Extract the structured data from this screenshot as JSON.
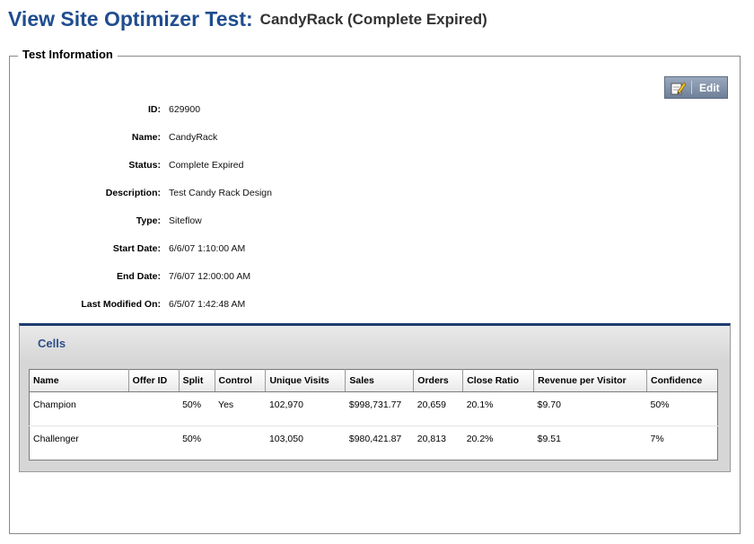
{
  "header": {
    "title": "View Site Optimizer Test:",
    "subtitle": "CandyRack (Complete Expired)"
  },
  "test_info": {
    "legend": "Test Information",
    "edit_label": "Edit",
    "fields": [
      {
        "label": "ID:",
        "value": "629900"
      },
      {
        "label": "Name:",
        "value": "CandyRack"
      },
      {
        "label": "Status:",
        "value": "Complete Expired"
      },
      {
        "label": "Description:",
        "value": "Test Candy Rack Design"
      },
      {
        "label": "Type:",
        "value": "Siteflow"
      },
      {
        "label": "Start Date:",
        "value": "6/6/07 1:10:00 AM"
      },
      {
        "label": "End Date:",
        "value": "7/6/07 12:00:00 AM"
      },
      {
        "label": "Last Modified On:",
        "value": "6/5/07 1:42:48 AM"
      }
    ]
  },
  "cells": {
    "title": "Cells",
    "columns": [
      "Name",
      "Offer ID",
      "Split",
      "Control",
      "Unique Visits",
      "Sales",
      "Orders",
      "Close Ratio",
      "Revenue per Visitor",
      "Confidence"
    ],
    "rows": [
      [
        "Champion",
        "",
        "50%",
        "Yes",
        "102,970",
        "$998,731.77",
        "20,659",
        "20.1%",
        "$9.70",
        "50%"
      ],
      [
        "Challenger",
        "",
        "50%",
        "",
        "103,050",
        "$980,421.87",
        "20,813",
        "20.2%",
        "$9.51",
        "7%"
      ]
    ]
  },
  "colors": {
    "title": "#1f4d8f",
    "panel_accent": "#1f3c70",
    "edit_button": "#7d8ea6"
  },
  "icons": {
    "edit": "pencil-notepad-icon"
  }
}
